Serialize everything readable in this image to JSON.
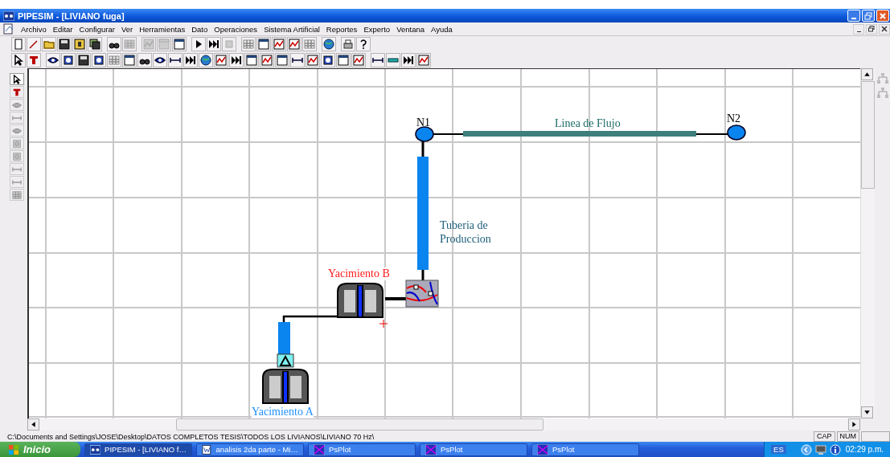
{
  "window": {
    "title": "PIPESIM - [LIVIANO fuga]"
  },
  "menu": [
    "Archivo",
    "Editar",
    "Configurar",
    "Ver",
    "Herramientas",
    "Dato",
    "Operaciones",
    "Sistema Artificial",
    "Reportes",
    "Experto",
    "Ventana",
    "Ayuda"
  ],
  "toolbars": [
    [
      [
        {
          "disabled": false
        },
        {
          "disabled": false
        },
        {
          "disabled": false
        },
        {
          "disabled": false
        },
        {
          "disabled": false
        },
        {
          "disabled": false
        }
      ],
      [
        {
          "disabled": false
        },
        {
          "disabled": true
        }
      ],
      [
        {
          "disabled": true
        },
        {
          "disabled": true
        },
        {
          "disabled": false
        }
      ],
      [
        {
          "disabled": false
        },
        {
          "disabled": false
        },
        {
          "disabled": true
        }
      ],
      [
        {
          "disabled": false
        },
        {
          "disabled": false
        },
        {
          "disabled": false
        },
        {
          "disabled": false
        },
        {
          "disabled": false
        }
      ],
      [
        {
          "disabled": false
        }
      ],
      [
        {
          "disabled": false
        },
        {
          "disabled": false
        }
      ]
    ],
    [
      [
        {
          "disabled": false
        },
        {
          "disabled": false
        }
      ],
      [
        {
          "disabled": false
        },
        {
          "disabled": false
        },
        {
          "disabled": false
        },
        {
          "disabled": false
        },
        {
          "disabled": false
        },
        {
          "disabled": false
        },
        {
          "disabled": false
        },
        {
          "disabled": false
        },
        {
          "disabled": false
        },
        {
          "disabled": false
        },
        {
          "disabled": false
        },
        {
          "disabled": false
        },
        {
          "disabled": false
        },
        {
          "disabled": false
        },
        {
          "disabled": false
        },
        {
          "disabled": false
        },
        {
          "disabled": false
        },
        {
          "disabled": false
        },
        {
          "disabled": false
        },
        {
          "disabled": false
        },
        {
          "disabled": false
        }
      ],
      [
        {
          "disabled": false
        },
        {
          "disabled": false
        },
        {
          "disabled": false
        },
        {
          "disabled": false
        }
      ]
    ]
  ],
  "palette": [
    {
      "disabled": false
    },
    {
      "disabled": false
    },
    {
      "disabled": true
    },
    {
      "disabled": true
    },
    {
      "disabled": true
    },
    {
      "disabled": true
    },
    {
      "disabled": true
    },
    {
      "disabled": true
    },
    {
      "disabled": true
    },
    {
      "disabled": true
    }
  ],
  "diagram": {
    "nodes": [
      {
        "label": "N1"
      },
      {
        "label": "N2"
      }
    ],
    "flowline": {
      "label": "Linea de Flujo"
    },
    "tubing": {
      "label": "Tuberia de Produccion"
    },
    "reservoirs": [
      {
        "label": "Yacimiento B",
        "color": "#ff1a1a"
      },
      {
        "label": "Yacimiento A",
        "color": "#1e90ff"
      }
    ]
  },
  "status_bar": {
    "path": "C:\\Documents and Settings\\JOSE\\Desktop\\DATOS COMPLETOS TESIS\\TODOS LOS LIVIANOS\\LIVIANO 70 Hz\\",
    "indicators": [
      "CAP",
      "NUM"
    ]
  },
  "taskbar": {
    "start": "Inicio",
    "tasks": [
      {
        "label": "PIPESIM - [LIVIANO f…",
        "selected": true,
        "kind": "app"
      },
      {
        "label": "analisis 2da parte - Mi…",
        "selected": false,
        "kind": "doc"
      },
      {
        "label": "PsPlot",
        "selected": false,
        "kind": "plot"
      },
      {
        "label": "PsPlot",
        "selected": false,
        "kind": "plot"
      },
      {
        "label": "PsPlot",
        "selected": false,
        "kind": "plot"
      }
    ],
    "language": "ES",
    "clock": "02:29 p.m."
  }
}
